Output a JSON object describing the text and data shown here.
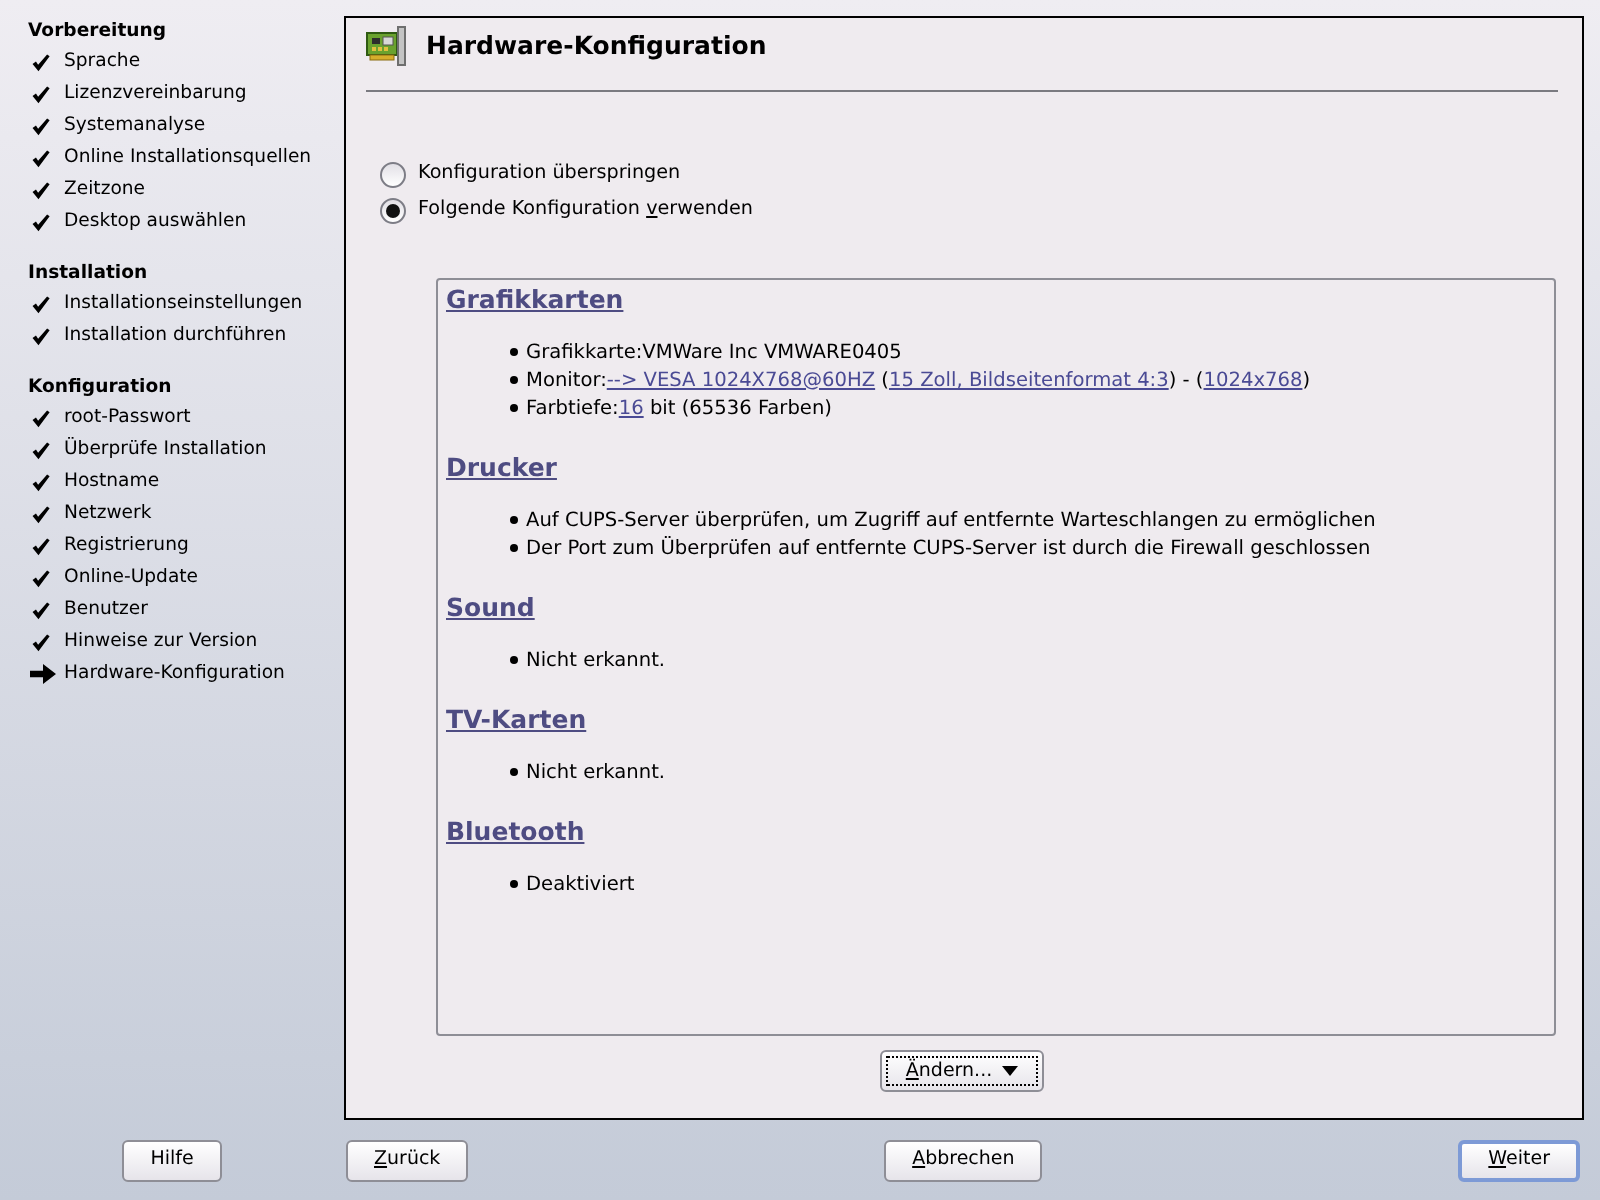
{
  "sidebar": {
    "groups": [
      {
        "title": "Vorbereitung",
        "items": [
          {
            "label": "Sprache",
            "current": false
          },
          {
            "label": "Lizenzvereinbarung",
            "current": false
          },
          {
            "label": "Systemanalyse",
            "current": false
          },
          {
            "label": "Online Installationsquellen",
            "current": false
          },
          {
            "label": "Zeitzone",
            "current": false
          },
          {
            "label": "Desktop auswählen",
            "current": false
          }
        ]
      },
      {
        "title": "Installation",
        "items": [
          {
            "label": "Installationseinstellungen",
            "current": false
          },
          {
            "label": "Installation durchführen",
            "current": false
          }
        ]
      },
      {
        "title": "Konfiguration",
        "items": [
          {
            "label": "root-Passwort",
            "current": false
          },
          {
            "label": "Überprüfe Installation",
            "current": false
          },
          {
            "label": "Hostname",
            "current": false
          },
          {
            "label": "Netzwerk",
            "current": false
          },
          {
            "label": "Registrierung",
            "current": false
          },
          {
            "label": "Online-Update",
            "current": false
          },
          {
            "label": "Benutzer",
            "current": false
          },
          {
            "label": "Hinweise zur Version",
            "current": false
          },
          {
            "label": "Hardware-Konfiguration",
            "current": true
          }
        ]
      }
    ]
  },
  "header": {
    "title": "Hardware-Konfiguration"
  },
  "options": [
    {
      "label": {
        "before": "Konfiguration überspringen"
      },
      "selected": false
    },
    {
      "label": {
        "before": "Folgende Konfiguration ",
        "underlined": "v",
        "after": "erwenden"
      },
      "selected": true
    }
  ],
  "summary": {
    "sections": [
      {
        "heading": "Grafikkarten",
        "items": [
          [
            {
              "text": "Grafikkarte:VMWare Inc VMWARE0405",
              "link": false
            }
          ],
          [
            {
              "text": "Monitor:",
              "link": false
            },
            {
              "text": "--> VESA 1024X768@60HZ",
              "link": true
            },
            {
              "text": " (",
              "link": false
            },
            {
              "text": "15 Zoll, Bildseitenformat 4:3",
              "link": true
            },
            {
              "text": ") - (",
              "link": false
            },
            {
              "text": "1024x768",
              "link": true
            },
            {
              "text": ")",
              "link": false
            }
          ],
          [
            {
              "text": "Farbtiefe:",
              "link": false
            },
            {
              "text": "16",
              "link": true
            },
            {
              "text": " bit (65536 Farben)",
              "link": false
            }
          ]
        ]
      },
      {
        "heading": "Drucker",
        "items": [
          [
            {
              "text": "Auf CUPS-Server überprüfen, um Zugriff auf entfernte Warteschlangen zu ermöglichen",
              "link": false
            }
          ],
          [
            {
              "text": "Der Port zum Überprüfen auf entfernte CUPS-Server ist durch die Firewall geschlossen",
              "link": false
            }
          ]
        ]
      },
      {
        "heading": "Sound",
        "items": [
          [
            {
              "text": "Nicht erkannt.",
              "link": false
            }
          ]
        ]
      },
      {
        "heading": "TV-Karten",
        "items": [
          [
            {
              "text": "Nicht erkannt.",
              "link": false
            }
          ]
        ]
      },
      {
        "heading": "Bluetooth",
        "items": [
          [
            {
              "text": "Deaktiviert",
              "link": false
            }
          ]
        ]
      }
    ]
  },
  "change_button": {
    "label": {
      "underlined": "Ä",
      "after": "ndern..."
    },
    "focused": true
  },
  "buttons": [
    {
      "label": {
        "before": "Hilfe"
      },
      "default": false
    },
    {
      "label": {
        "underlined": "Z",
        "after": "urück"
      },
      "default": false
    },
    {
      "label": {
        "underlined": "A",
        "after": "bbrechen"
      },
      "default": false
    },
    {
      "label": {
        "underlined": "W",
        "after": "eiter"
      },
      "default": true
    }
  ]
}
